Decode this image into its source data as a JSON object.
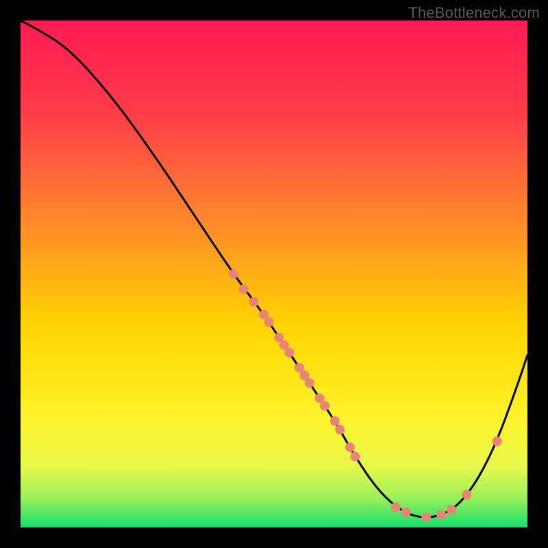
{
  "watermark": "TheBottleneck.com",
  "chart_data": {
    "type": "line",
    "title": "",
    "xlabel": "",
    "ylabel": "",
    "xlim": [
      0,
      100
    ],
    "ylim": [
      0,
      100
    ],
    "background_gradient_top": "#ff1a53",
    "background_gradient_mid": "#ffd400",
    "background_gradient_bottom": "#12e06b",
    "series": [
      {
        "name": "curve",
        "color": "#000000",
        "x": [
          0,
          4,
          10,
          18,
          26,
          34,
          42,
          48,
          54,
          58,
          62,
          66,
          70,
          74,
          78,
          82,
          86,
          90,
          94,
          98,
          100
        ],
        "y": [
          100,
          98,
          94,
          85,
          74,
          62,
          50,
          42,
          33,
          27,
          21,
          14,
          8,
          4,
          2,
          2,
          4,
          9,
          17,
          28,
          34
        ]
      }
    ],
    "markers": {
      "color": "#e98377",
      "radius": 7,
      "points": [
        {
          "x": 42,
          "y": 50
        },
        {
          "x": 44,
          "y": 47
        },
        {
          "x": 46,
          "y": 44.5
        },
        {
          "x": 48,
          "y": 42
        },
        {
          "x": 49,
          "y": 40.5
        },
        {
          "x": 51,
          "y": 37.5
        },
        {
          "x": 52,
          "y": 36
        },
        {
          "x": 53,
          "y": 34.5
        },
        {
          "x": 55,
          "y": 31.5
        },
        {
          "x": 56,
          "y": 30
        },
        {
          "x": 57,
          "y": 28.5
        },
        {
          "x": 59,
          "y": 25.5
        },
        {
          "x": 60,
          "y": 24
        },
        {
          "x": 62,
          "y": 21
        },
        {
          "x": 63,
          "y": 19.3
        },
        {
          "x": 65,
          "y": 15.8
        },
        {
          "x": 66,
          "y": 14
        },
        {
          "x": 74,
          "y": 4
        },
        {
          "x": 76,
          "y": 3
        },
        {
          "x": 80,
          "y": 2
        },
        {
          "x": 83,
          "y": 2.5
        },
        {
          "x": 85,
          "y": 3.5
        },
        {
          "x": 88,
          "y": 6.5
        },
        {
          "x": 94,
          "y": 17
        }
      ]
    }
  }
}
